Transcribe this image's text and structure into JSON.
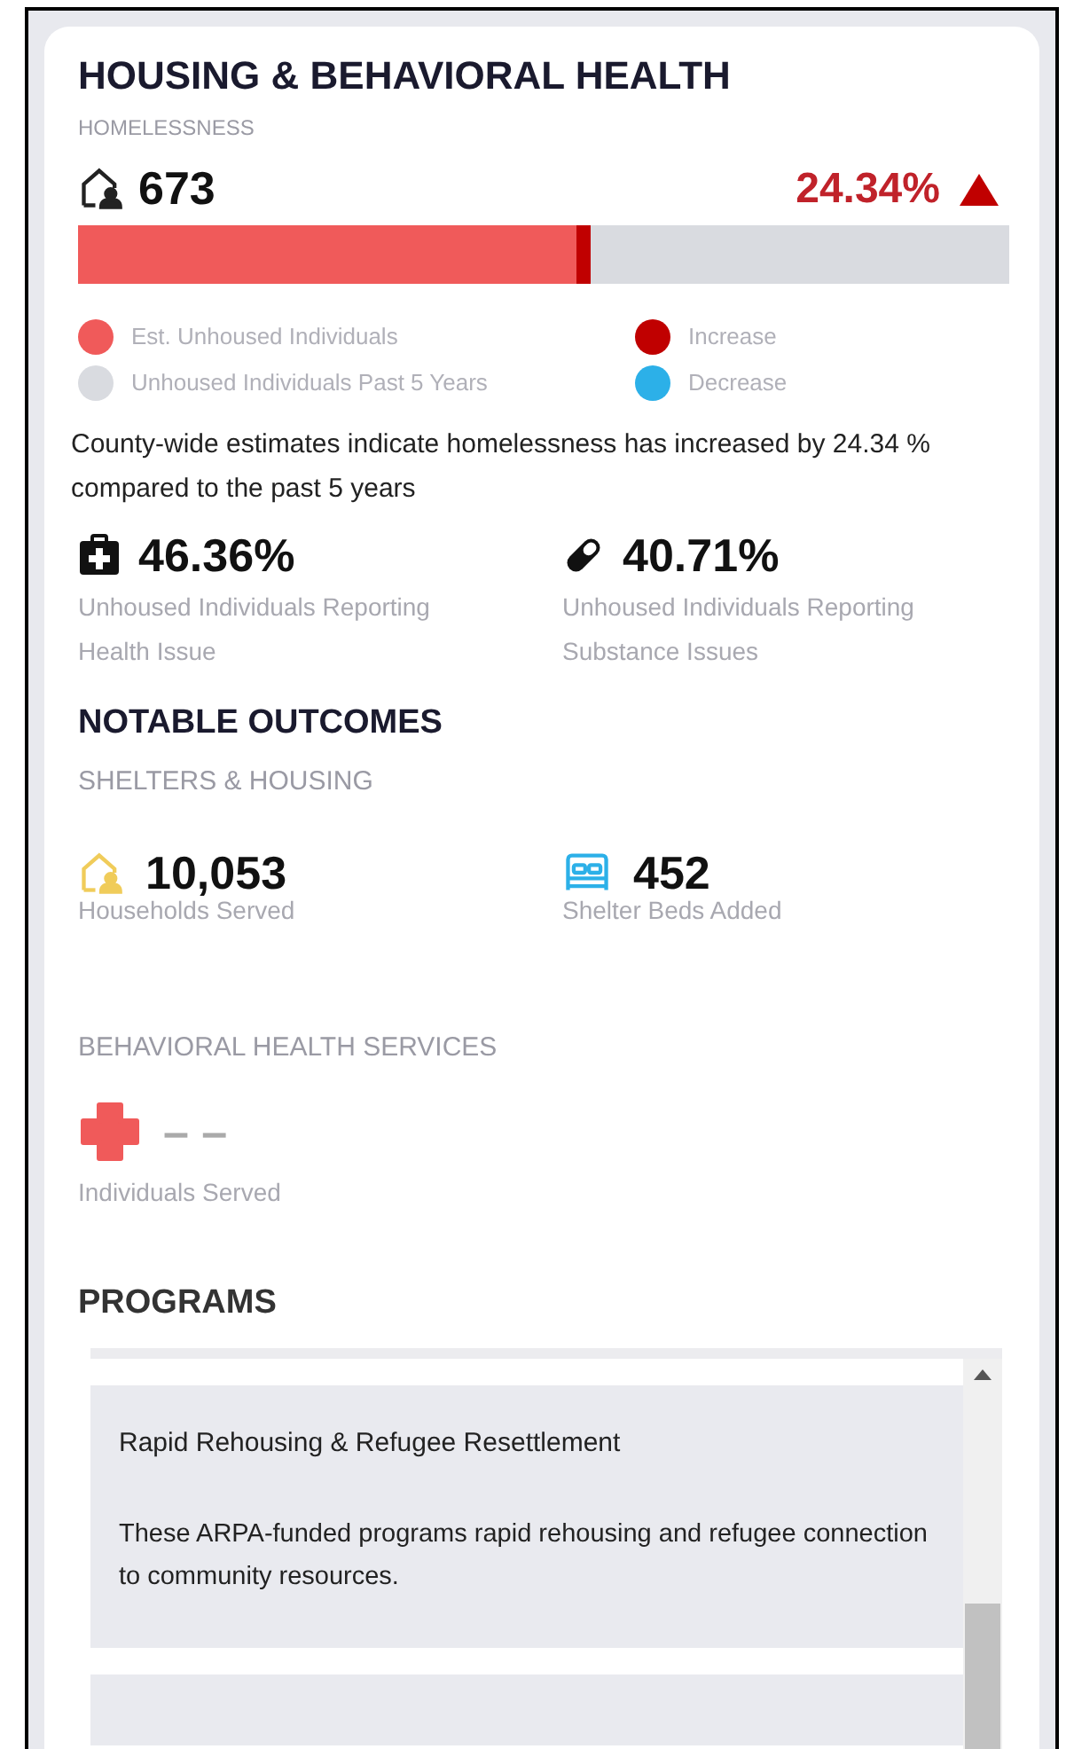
{
  "title": "HOUSING & BEHAVIORAL HEALTH",
  "homelessness": {
    "heading": "HOMELESSNESS",
    "count": "673",
    "change": "24.34%",
    "increasing": true,
    "level": 0.55,
    "legend": [
      {
        "label": "Est. Unhoused Individuals",
        "color": "#f05a5a"
      },
      {
        "label": "Increase",
        "color": "#c00000"
      },
      {
        "label": "Unhoused Individuals Past 5 Years",
        "color": "#d9dbe0"
      },
      {
        "label": "Decrease",
        "color": "#2cb0e8"
      }
    ],
    "summary": "County-wide estimates indicate homelessness has increased by 24.34 % compared to the past 5 years"
  },
  "stats": [
    {
      "kind": "medkit",
      "value": "46.36%",
      "label": "Unhoused Individuals Reporting Health Issue"
    },
    {
      "kind": "pill",
      "value": "40.71%",
      "label": "Unhoused Individuals Reporting Substance Issues"
    }
  ],
  "outcomes": {
    "heading": "NOTABLE OUTCOMES",
    "sections": [
      {
        "heading": "SHELTERS & HOUSING",
        "items": [
          {
            "kind": "house",
            "value": "10,053",
            "label": "Households Served"
          },
          {
            "kind": "bed",
            "value": "452",
            "label": "Shelter Beds Added"
          }
        ]
      },
      {
        "heading": "BEHAVIORAL HEALTH SERVICES",
        "items": [
          {
            "kind": "cross",
            "value": "– –",
            "label": "Individuals Served"
          }
        ]
      }
    ]
  },
  "programs": {
    "heading": "PROGRAMS",
    "items": [
      {
        "name": "Rapid Rehousing & Refugee Resettlement",
        "description": "These ARPA-funded programs rapid rehousing and refugee connection to community resources."
      }
    ]
  }
}
